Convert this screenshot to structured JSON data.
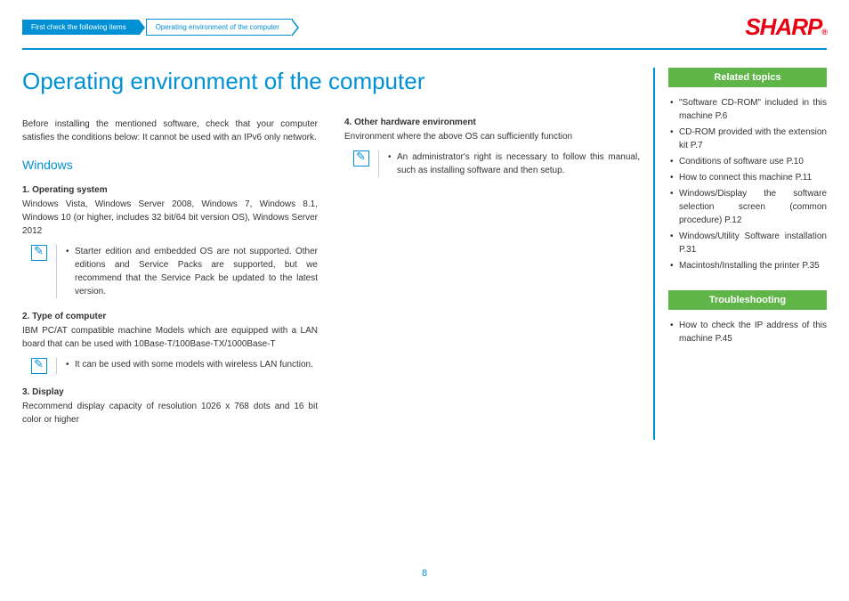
{
  "breadcrumb": {
    "prev": "First check the following items",
    "current": "Operating environment of the computer"
  },
  "logo": "SHARP",
  "title": "Operating environment of the computer",
  "intro": "Before installing the mentioned software, check that your computer satisfies the conditions below: It cannot be used with an IPv6 only network.",
  "h2": "Windows",
  "s1": {
    "h": "1. Operating system",
    "p": "Windows Vista, Windows Server 2008, Windows 7, Windows 8.1, Windows 10 (or higher, includes 32 bit/64 bit version OS), Windows Server 2012",
    "note": "Starter edition and embedded OS are not supported. Other editions and Service Packs are supported, but we recommend that the Service Pack be updated to the latest version."
  },
  "s2": {
    "h": "2. Type of computer",
    "p": "IBM PC/AT compatible machine Models which are equipped with a LAN board that can be used with 10Base-T/100Base-TX/1000Base-T",
    "note": "It can be used with some models with wireless LAN function."
  },
  "s3": {
    "h": "3. Display",
    "p": "Recommend display capacity of resolution 1026 x 768 dots and 16 bit color or higher"
  },
  "s4": {
    "h": "4. Other hardware environment",
    "p": "Environment where the above OS can sufficiently function",
    "note": "An administrator's right is necessary to follow this manual, such as installing software and then setup."
  },
  "related": {
    "h": "Related topics",
    "items": [
      "\"Software CD-ROM\" included in this machine P.6",
      "CD-ROM provided with the extension kit P.7",
      "Conditions of software use P.10",
      "How to connect this machine P.11",
      "Windows/Display the software selection screen (common procedure) P.12",
      "Windows/Utility Software installation P.31",
      "Macintosh/Installing the printer P.35"
    ]
  },
  "trouble": {
    "h": "Troubleshooting",
    "items": [
      "How to check the IP address of this machine P.45"
    ]
  },
  "page": "8"
}
